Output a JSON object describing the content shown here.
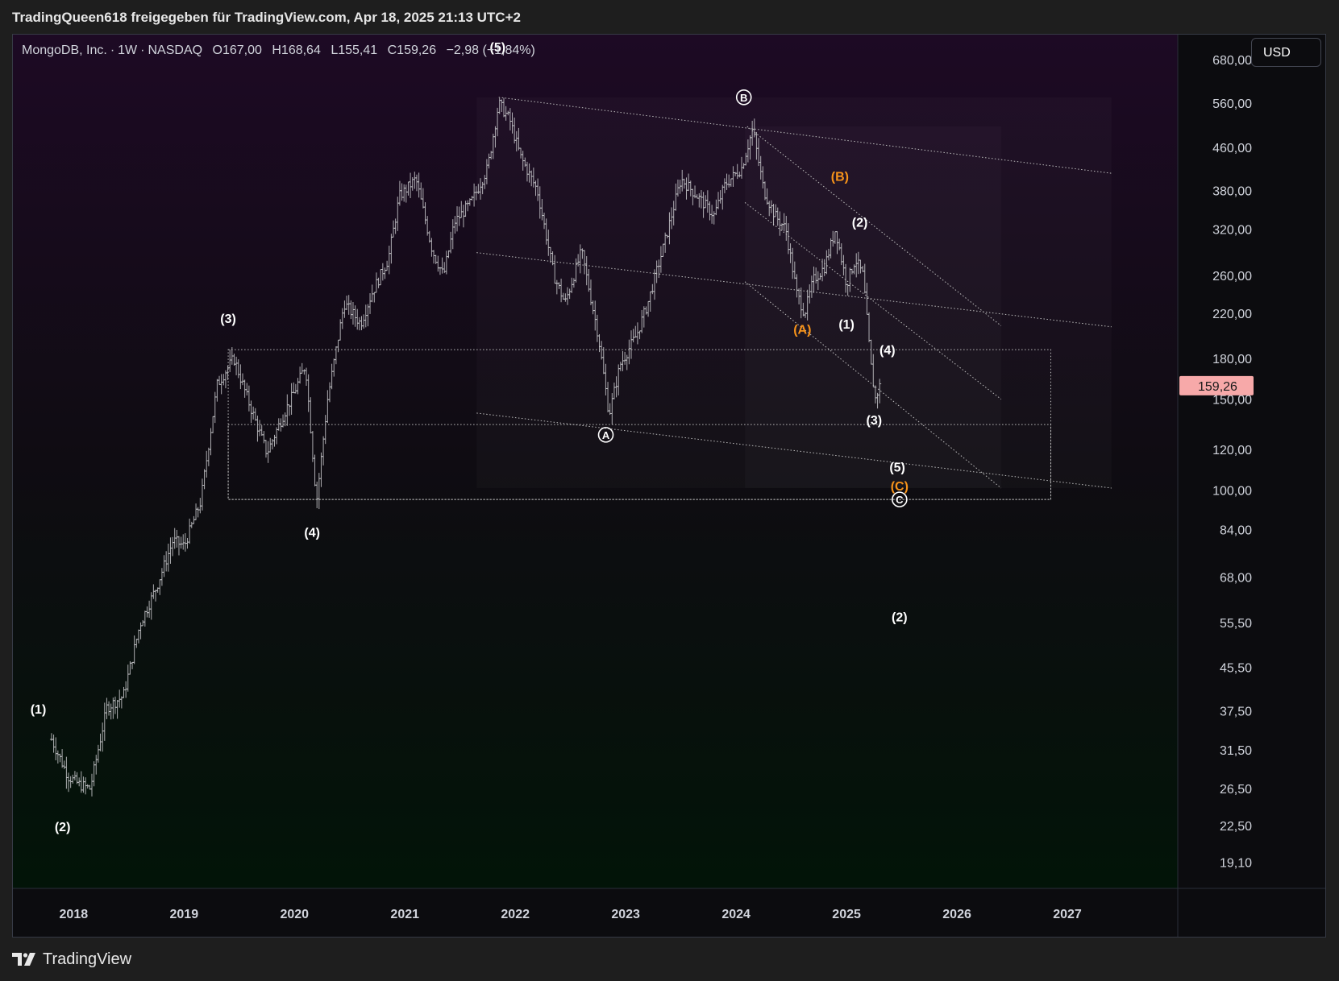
{
  "header": {
    "publisher_line": "TradingQueen618 freigegeben für TradingView.com, Apr 18, 2025 21:13 UTC+2"
  },
  "legend": {
    "symbol": "MongoDB, Inc.",
    "interval": "1W",
    "exchange": "NASDAQ",
    "open": "O167,00",
    "high": "H168,64",
    "low": "L155,41",
    "close": "C159,26",
    "change": "−2,98 (−1,84%)"
  },
  "currency_button": "USD",
  "footer": {
    "brand": "TradingView"
  },
  "colors": {
    "bg_top": "#1d0a24",
    "bg_bottom": "#021408",
    "candle": "#c9c9cc",
    "orange_label": "#f7931a",
    "price_badge": "#f7a9a9",
    "line": "#bdbdbd"
  },
  "chart_data": {
    "type": "candlestick",
    "scale": "log",
    "ylim": [
      17,
      760
    ],
    "xlim": [
      2017.45,
      2028.0
    ],
    "x_ticks": [
      "2018",
      "2019",
      "2020",
      "2021",
      "2022",
      "2023",
      "2024",
      "2025",
      "2026",
      "2027"
    ],
    "y_ticks": [
      "680,00",
      "560,00",
      "460,00",
      "380,00",
      "320,00",
      "260,00",
      "220,00",
      "180,00",
      "150,00",
      "120,00",
      "100,00",
      "84,00",
      "68,00",
      "55,50",
      "45,50",
      "37,50",
      "31,50",
      "26,50",
      "22,50",
      "19,10"
    ],
    "last_price": "159,26",
    "last_price_value": 159.26,
    "price_path": [
      [
        2017.8,
        33
      ],
      [
        2017.95,
        28
      ],
      [
        2018.05,
        27
      ],
      [
        2018.15,
        26.5
      ],
      [
        2018.3,
        38
      ],
      [
        2018.45,
        40
      ],
      [
        2018.6,
        55
      ],
      [
        2018.75,
        65
      ],
      [
        2018.9,
        80
      ],
      [
        2019.0,
        78
      ],
      [
        2019.15,
        95
      ],
      [
        2019.3,
        160
      ],
      [
        2019.45,
        180
      ],
      [
        2019.6,
        145
      ],
      [
        2019.75,
        118
      ],
      [
        2019.9,
        140
      ],
      [
        2020.0,
        155
      ],
      [
        2020.1,
        175
      ],
      [
        2020.2,
        95
      ],
      [
        2020.3,
        150
      ],
      [
        2020.45,
        230
      ],
      [
        2020.6,
        210
      ],
      [
        2020.7,
        240
      ],
      [
        2020.85,
        280
      ],
      [
        2020.95,
        370
      ],
      [
        2021.1,
        400
      ],
      [
        2021.25,
        290
      ],
      [
        2021.35,
        260
      ],
      [
        2021.45,
        330
      ],
      [
        2021.6,
        360
      ],
      [
        2021.75,
        420
      ],
      [
        2021.85,
        560
      ],
      [
        2021.95,
        520
      ],
      [
        2022.05,
        440
      ],
      [
        2022.2,
        380
      ],
      [
        2022.35,
        260
      ],
      [
        2022.45,
        230
      ],
      [
        2022.6,
        290
      ],
      [
        2022.75,
        200
      ],
      [
        2022.85,
        140
      ],
      [
        2022.95,
        175
      ],
      [
        2023.1,
        200
      ],
      [
        2023.2,
        230
      ],
      [
        2023.35,
        300
      ],
      [
        2023.5,
        400
      ],
      [
        2023.65,
        370
      ],
      [
        2023.8,
        340
      ],
      [
        2023.9,
        390
      ],
      [
        2024.05,
        420
      ],
      [
        2024.15,
        500
      ],
      [
        2024.25,
        380
      ],
      [
        2024.35,
        340
      ],
      [
        2024.45,
        320
      ],
      [
        2024.55,
        240
      ],
      [
        2024.62,
        220
      ],
      [
        2024.7,
        255
      ],
      [
        2024.8,
        270
      ],
      [
        2024.9,
        320
      ],
      [
        2025.0,
        250
      ],
      [
        2025.08,
        280
      ],
      [
        2025.15,
        260
      ],
      [
        2025.22,
        175
      ],
      [
        2025.26,
        150
      ],
      [
        2025.3,
        159
      ]
    ],
    "annotations": [
      {
        "text": "(1)",
        "x": 2017.68,
        "y": 37.8,
        "color": "white"
      },
      {
        "text": "(2)",
        "x": 2017.9,
        "y": 22.4,
        "color": "white"
      },
      {
        "text": "(3)",
        "x": 2019.4,
        "y": 215,
        "color": "white"
      },
      {
        "text": "(4)",
        "x": 2020.16,
        "y": 83,
        "color": "white"
      },
      {
        "text": "(5)",
        "x": 2021.84,
        "y": 720,
        "color": "white"
      },
      {
        "text": "A",
        "x": 2022.82,
        "y": 128,
        "color": "white",
        "circled": true
      },
      {
        "text": "B",
        "x": 2024.07,
        "y": 575,
        "color": "white",
        "circled": true
      },
      {
        "text": "(A)",
        "x": 2024.6,
        "y": 205,
        "color": "orange"
      },
      {
        "text": "(B)",
        "x": 2024.94,
        "y": 405,
        "color": "orange"
      },
      {
        "text": "(1)",
        "x": 2025.0,
        "y": 210,
        "color": "white"
      },
      {
        "text": "(2)",
        "x": 2025.12,
        "y": 330,
        "color": "white"
      },
      {
        "text": "(3)",
        "x": 2025.25,
        "y": 137,
        "color": "white"
      },
      {
        "text": "(4)",
        "x": 2025.37,
        "y": 187,
        "color": "white"
      },
      {
        "text": "(5)",
        "x": 2025.46,
        "y": 111,
        "color": "white"
      },
      {
        "text": "(C)",
        "x": 2025.48,
        "y": 102,
        "color": "orange"
      },
      {
        "text": "C",
        "x": 2025.48,
        "y": 96,
        "color": "white",
        "circled": true
      },
      {
        "text": "(2)",
        "x": 2025.48,
        "y": 57,
        "color": "white"
      }
    ],
    "trendlines": [
      {
        "from": [
          2021.85,
          575
        ],
        "to": [
          2027.4,
          410
        ]
      },
      {
        "from": [
          2021.65,
          288
        ],
        "to": [
          2027.4,
          207
        ]
      },
      {
        "from": [
          2021.65,
          141
        ],
        "to": [
          2027.4,
          101
        ]
      },
      {
        "from": [
          2024.1,
          505
        ],
        "to": [
          2026.4,
          208
        ]
      },
      {
        "from": [
          2024.08,
          360
        ],
        "to": [
          2026.4,
          150
        ]
      },
      {
        "from": [
          2024.08,
          253
        ],
        "to": [
          2026.4,
          101
        ]
      }
    ],
    "rectangles": [
      {
        "from": [
          2019.4,
          187
        ],
        "to": [
          2026.85,
          96
        ]
      },
      {
        "from": [
          2019.4,
          134
        ],
        "to": [
          2026.85,
          96
        ]
      }
    ],
    "shaded_regions": [
      {
        "from": [
          2021.65,
          575
        ],
        "to": [
          2027.4,
          101
        ]
      },
      {
        "from": [
          2024.08,
          505
        ],
        "to": [
          2026.4,
          101
        ]
      }
    ]
  }
}
